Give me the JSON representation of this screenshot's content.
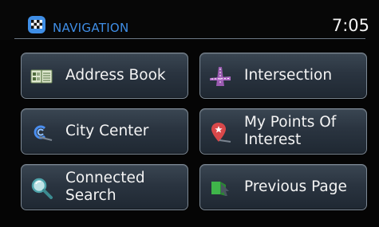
{
  "header": {
    "title": "NAVIGATION",
    "time": "7:05",
    "icon": "checkered-flag-icon"
  },
  "menu": {
    "address_book": {
      "label": "Address Book",
      "icon": "address-book-icon"
    },
    "intersection": {
      "label": "Intersection",
      "icon": "intersection-icon"
    },
    "city_center": {
      "label": "City Center",
      "icon": "city-center-icon"
    },
    "my_points_of_interest": {
      "label": "My Points Of Interest",
      "icon": "map-pin-star-icon"
    },
    "connected_search": {
      "label": "Connected Search",
      "icon": "magnifier-icon"
    },
    "previous_page": {
      "label": "Previous Page",
      "icon": "back-arrow-icon"
    }
  },
  "colors": {
    "title_blue": "#3f8ee6",
    "button_border": "#7c8894",
    "button_fill": "#2a3440",
    "background": "#050505"
  }
}
